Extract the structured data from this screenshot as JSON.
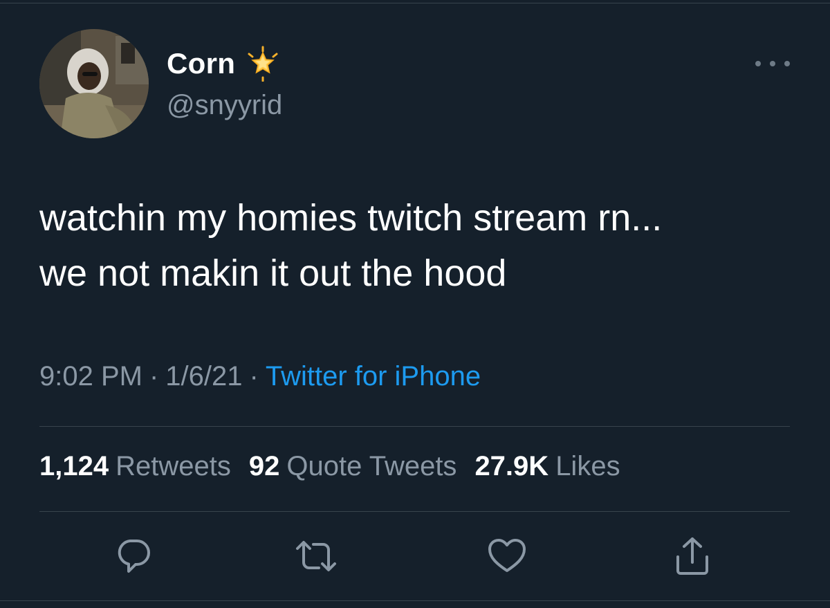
{
  "tweet": {
    "display_name": "Corn",
    "handle": "@snyyrid",
    "badge_icon": "glowing-star-icon",
    "text": "watchin my homies twitch stream rn...\nwe not makin it out the hood",
    "time": "9:02 PM",
    "date": "1/6/21",
    "separator": "·",
    "source": "Twitter for iPhone"
  },
  "stats": {
    "retweets_count": "1,124",
    "retweets_label": "Retweets",
    "quotes_count": "92",
    "quotes_label": "Quote Tweets",
    "likes_count": "27.9K",
    "likes_label": "Likes"
  },
  "actions": [
    {
      "icon": "reply-icon"
    },
    {
      "icon": "retweet-icon"
    },
    {
      "icon": "like-icon"
    },
    {
      "icon": "share-icon"
    }
  ],
  "colors": {
    "background": "#15202b",
    "text_primary": "#ffffff",
    "text_secondary": "#8b98a5",
    "accent": "#1d9bf0",
    "divider": "#38444d"
  }
}
